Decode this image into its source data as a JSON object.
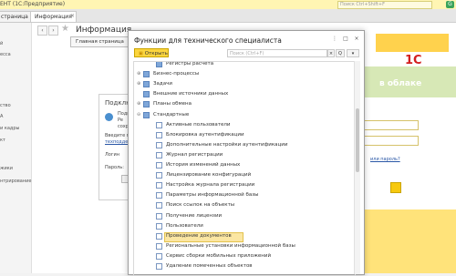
{
  "app": {
    "title": "ЕНТ (1С:Предприятие)",
    "search_placeholder": "Поиск Ctrl+Shift+F",
    "badge": "G"
  },
  "tabs": [
    {
      "label": "страница"
    },
    {
      "label": "Информация"
    }
  ],
  "sidebar": {
    "items": [
      "й",
      "есса",
      "ство",
      "А",
      "и кадры",
      "кт",
      "",
      "жики",
      "",
      "нтрирование"
    ]
  },
  "content": {
    "title": "Информация",
    "home_button": "Главная страница",
    "login_panel": {
      "title": "Подклю",
      "text1": "Подк",
      "text2": "Pe",
      "text3": "сохр",
      "enter_label": "Введите по",
      "help_link": "техподдерж",
      "login_label": "Логин",
      "password_label": "Пароль:"
    },
    "right_link": "или пароль?",
    "banner": {
      "logo": "1С",
      "text": "в облаке"
    }
  },
  "dialog": {
    "title": "Функции для технического специалиста",
    "open_button": "Открыть",
    "search_placeholder": "Поиск (Ctrl+F)",
    "search_clear": "×",
    "search_go": "Q",
    "more": "Еще",
    "tree": [
      {
        "label": "Регистры расчета",
        "level": 1,
        "kind": "folder"
      },
      {
        "label": "Бизнес-процессы",
        "level": 0,
        "kind": "folder",
        "exp": "⊕"
      },
      {
        "label": "Задачи",
        "level": 0,
        "kind": "folder",
        "exp": "⊕"
      },
      {
        "label": "Внешние источники данных",
        "level": 0,
        "kind": "folder"
      },
      {
        "label": "Планы обмена",
        "level": 0,
        "kind": "folder",
        "exp": "⊕"
      },
      {
        "label": "Стандартные",
        "level": 0,
        "kind": "folder",
        "exp": "⊖"
      },
      {
        "label": "Активные пользователи",
        "level": 1,
        "kind": "page"
      },
      {
        "label": "Блокировка аутентификации",
        "level": 1,
        "kind": "page"
      },
      {
        "label": "Дополнительные настройки аутентификации",
        "level": 1,
        "kind": "page"
      },
      {
        "label": "Журнал регистрации",
        "level": 1,
        "kind": "page"
      },
      {
        "label": "История изменений данных",
        "level": 1,
        "kind": "page"
      },
      {
        "label": "Лицензирование конфигураций",
        "level": 1,
        "kind": "page"
      },
      {
        "label": "Настройка журнала регистрации",
        "level": 1,
        "kind": "page"
      },
      {
        "label": "Параметры информационной базы",
        "level": 1,
        "kind": "page"
      },
      {
        "label": "Поиск ссылок на объекты",
        "level": 1,
        "kind": "page"
      },
      {
        "label": "Получение лицензии",
        "level": 1,
        "kind": "page"
      },
      {
        "label": "Пользователи",
        "level": 1,
        "kind": "page"
      },
      {
        "label": "Проведение документов",
        "level": 1,
        "kind": "page",
        "selected": true
      },
      {
        "label": "Региональные установки информационной базы",
        "level": 1,
        "kind": "page"
      },
      {
        "label": "Сервис сборки мобильных приложений",
        "level": 1,
        "kind": "page"
      },
      {
        "label": "Удаление помеченных объектов",
        "level": 1,
        "kind": "page"
      }
    ]
  }
}
